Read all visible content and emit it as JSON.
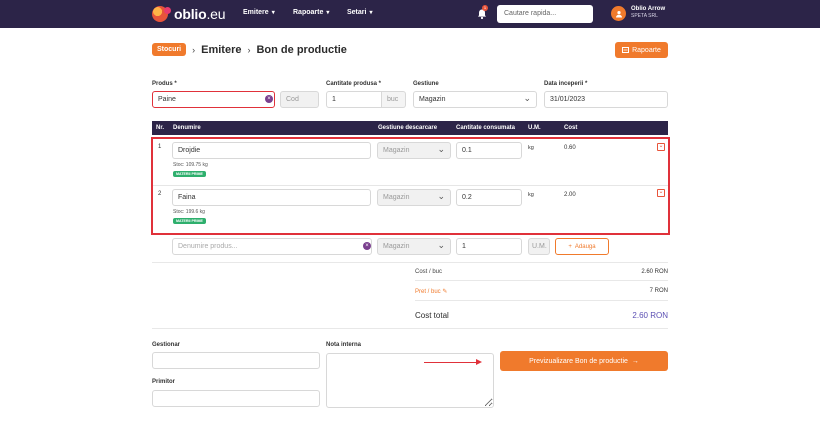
{
  "app": {
    "logo_main": "oblio",
    "logo_suffix": ".eu",
    "nav": [
      "Emitere",
      "Rapoarte",
      "Setari"
    ],
    "notification_count": "1",
    "search_placeholder": "Cautare rapida...",
    "user_name": "Oblio Arrow",
    "user_company": "SPETA SRL"
  },
  "breadcrumb": {
    "pill": "Stocuri",
    "items": [
      "Emitere",
      "Bon de productie"
    ]
  },
  "header_button": "Rapoarte",
  "form": {
    "produs_label": "Produs *",
    "produs_value": "Paine",
    "cod_placeholder": "Cod",
    "cantitate_label": "Cantitate produsa *",
    "cantitate_value": "1",
    "cantitate_unit": "buc",
    "gestiune_label": "Gestiune",
    "gestiune_value": "Magazin",
    "data_label": "Data inceperii *",
    "data_value": "31/01/2023"
  },
  "table": {
    "headers": [
      "Nr.",
      "Denumire",
      "Gestiune descarcare",
      "Cantitate consumata",
      "U.M.",
      "Cost"
    ],
    "rows": [
      {
        "nr": "1",
        "denumire": "Drojdie",
        "stoc": "Stoc: 109.75 kg",
        "badge": "MATERII PRIME",
        "gestiune": "Magazin",
        "cantitate": "0.1",
        "um": "kg",
        "cost": "0.60"
      },
      {
        "nr": "2",
        "denumire": "Faina",
        "stoc": "Stoc: 199.6 kg",
        "badge": "MATERII PRIME",
        "gestiune": "Magazin",
        "cantitate": "0.2",
        "um": "kg",
        "cost": "2.00"
      }
    ],
    "new_row": {
      "denumire_placeholder": "Denumire produs...",
      "gestiune": "Magazin",
      "cantitate": "1",
      "um_placeholder": "U.M.",
      "add_label": "Adauga"
    }
  },
  "summary": {
    "cost_buc_label": "Cost / buc",
    "cost_buc_value": "2.60 RON",
    "pret_buc_label": "Pret / buc",
    "pret_buc_value": "7 RON",
    "cost_total_label": "Cost total",
    "cost_total_value": "2.60 RON"
  },
  "footer": {
    "gestionar_label": "Gestionar",
    "nota_label": "Nota interna",
    "primitor_label": "Primitor",
    "preview_button": "Previzualizare Bon de productie"
  },
  "colors": {
    "navbar": "#2c2448",
    "accent": "#f07a2c",
    "highlight": "#e0313a",
    "badge": "#2eaf6d",
    "total": "#5b4fb3"
  }
}
